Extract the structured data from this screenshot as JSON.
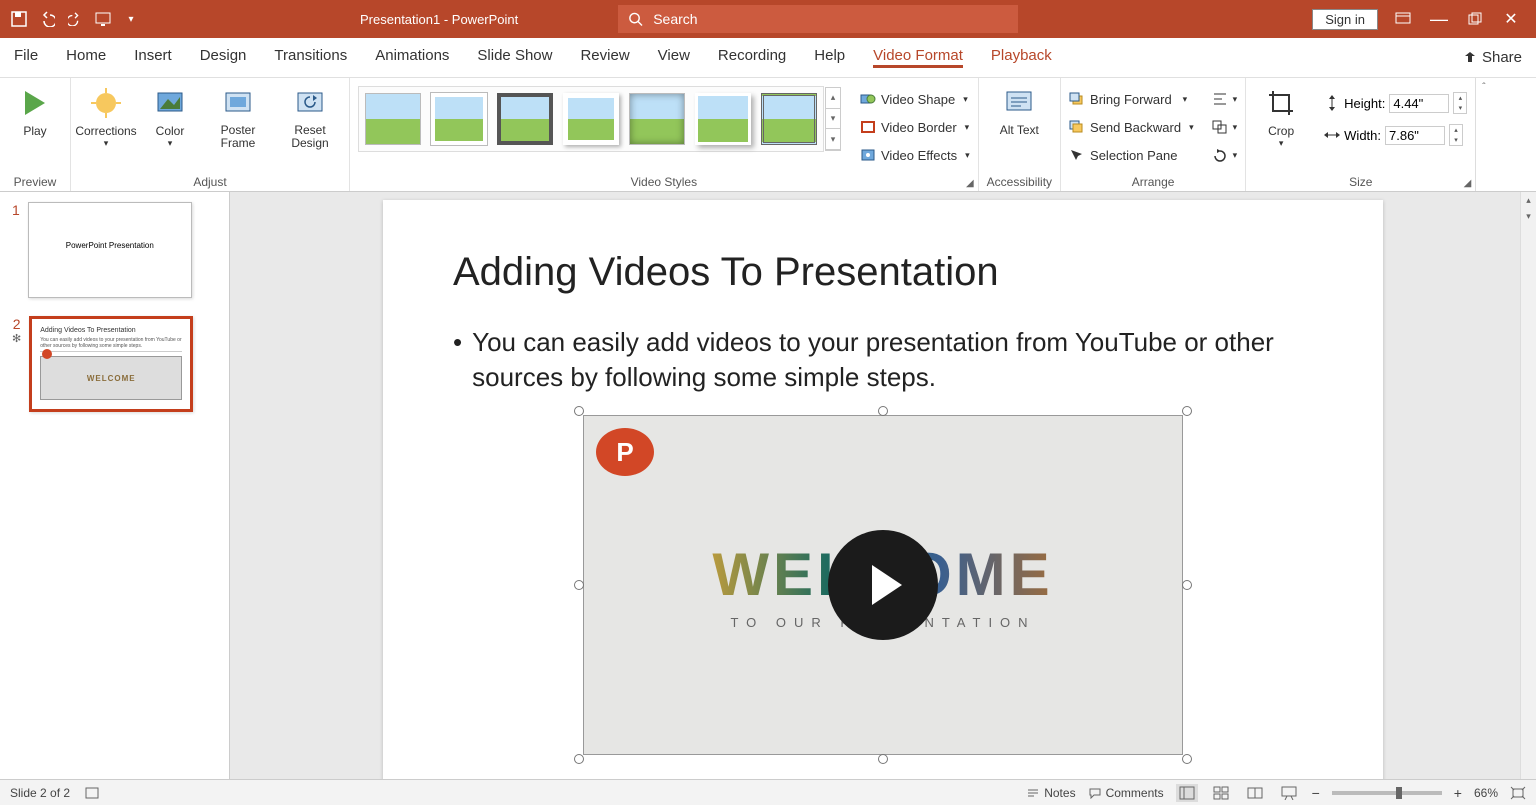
{
  "titlebar": {
    "doc_title": "Presentation1 - PowerPoint",
    "search_placeholder": "Search",
    "signin": "Sign in"
  },
  "tabs": [
    "File",
    "Home",
    "Insert",
    "Design",
    "Transitions",
    "Animations",
    "Slide Show",
    "Review",
    "View",
    "Recording",
    "Help",
    "Video Format",
    "Playback"
  ],
  "active_tab_index": 11,
  "share_label": "Share",
  "ribbon": {
    "preview": {
      "play": "Play",
      "group": "Preview"
    },
    "adjust": {
      "corrections": "Corrections",
      "color": "Color",
      "poster_frame": "Poster Frame",
      "reset_design": "Reset Design",
      "group": "Adjust"
    },
    "video_styles": {
      "video_shape": "Video Shape",
      "video_border": "Video Border",
      "video_effects": "Video Effects",
      "group": "Video Styles"
    },
    "accessibility": {
      "alt_text": "Alt Text",
      "group": "Accessibility"
    },
    "arrange": {
      "bring_forward": "Bring Forward",
      "send_backward": "Send Backward",
      "selection_pane": "Selection Pane",
      "group": "Arrange"
    },
    "size": {
      "crop": "Crop",
      "height_label": "Height:",
      "height_value": "4.44\"",
      "width_label": "Width:",
      "width_value": "7.86\"",
      "group": "Size"
    }
  },
  "thumbnails": [
    {
      "num": "1",
      "title": "PowerPoint Presentation"
    },
    {
      "num": "2",
      "title": "Adding Videos To Presentation",
      "body": "You can easily add videos to your presentation from YouTube or other sources by following some simple steps.",
      "video_caption": "WELCOME"
    }
  ],
  "slide": {
    "title": "Adding Videos To Presentation",
    "bullet": "You can easily add videos to your presentation from YouTube or other sources by following some simple steps.",
    "video": {
      "welcome_big": "WELCOME",
      "welcome_sub": "TO OUR PRESENTATION"
    }
  },
  "statusbar": {
    "slide_info": "Slide 2 of 2",
    "notes": "Notes",
    "comments": "Comments",
    "zoom": "66%"
  }
}
